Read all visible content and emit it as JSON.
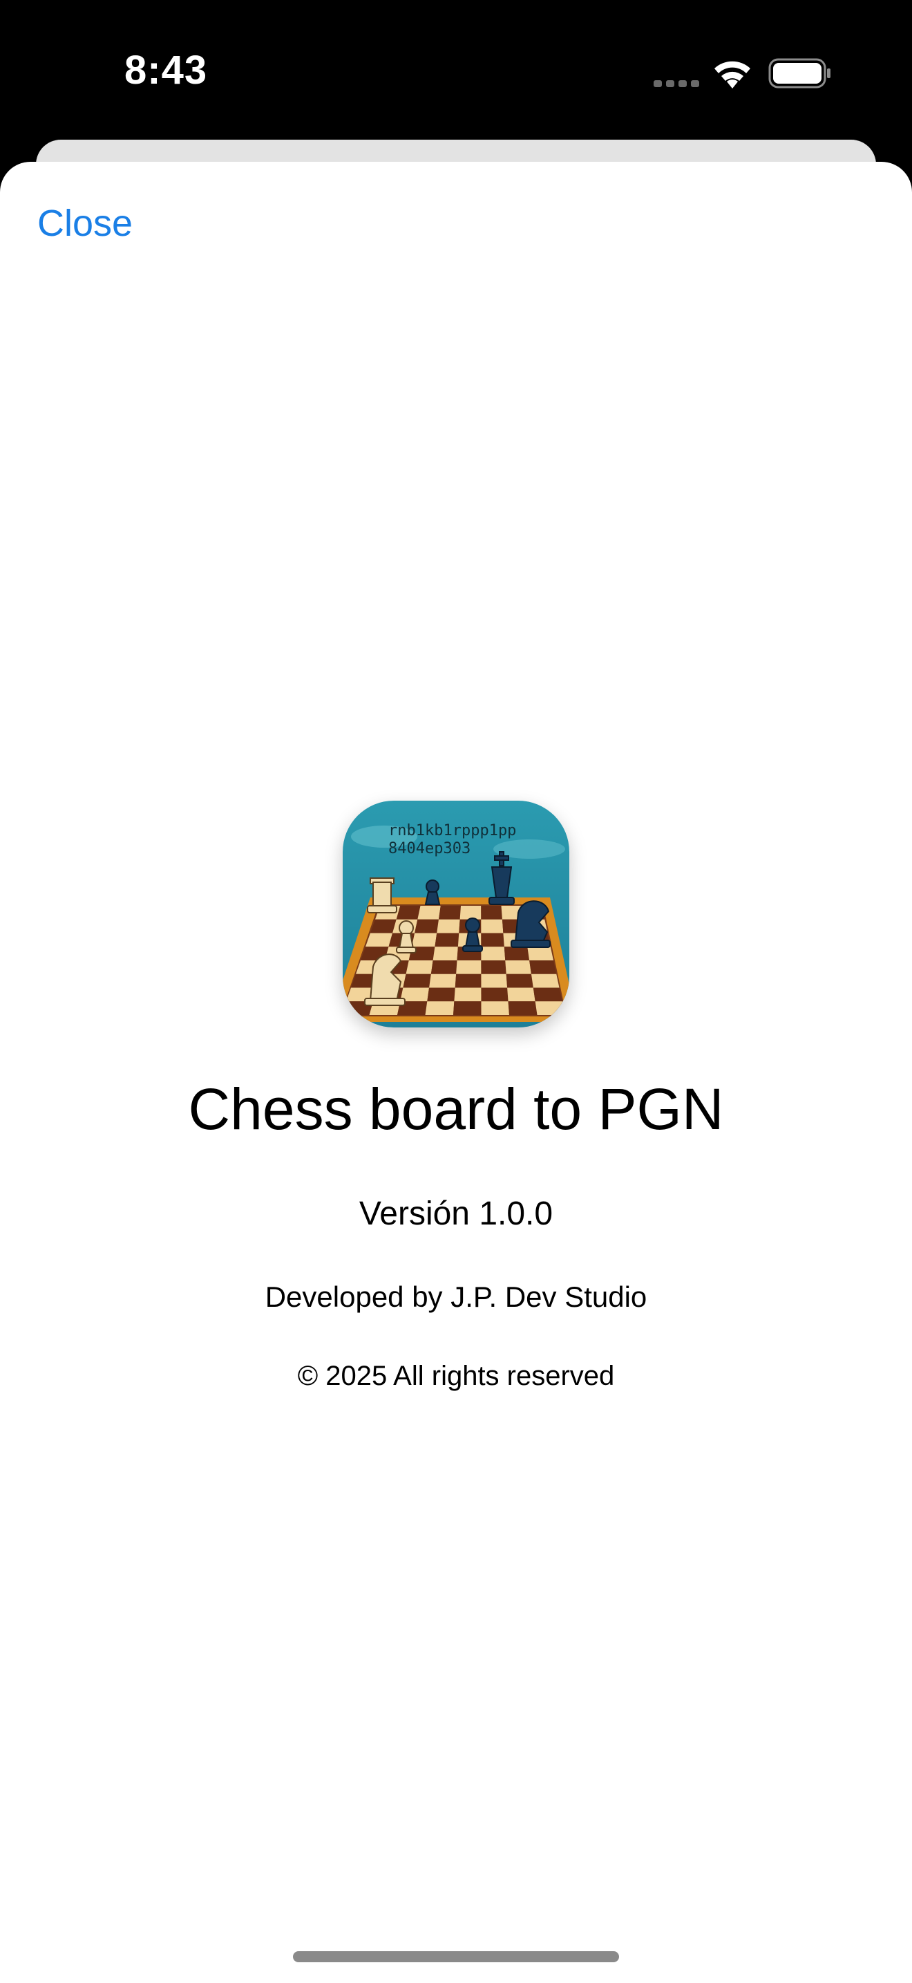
{
  "status_bar": {
    "time": "8:43",
    "icons": [
      "cellular-signal-icon",
      "wifi-icon",
      "battery-icon"
    ]
  },
  "sheet": {
    "close_label": "Close"
  },
  "about": {
    "app_icon": "chess-board-app-icon",
    "app_icon_text_line1": "rnb1kb1rppp1pp",
    "app_icon_text_line2": "8404ep303",
    "title": "Chess board to PGN",
    "version": "Versión 1.0.0",
    "developer": "Developed by J.P. Dev Studio",
    "copyright": "© 2025 All rights reserved"
  },
  "colors": {
    "accent": "#1a7fe6",
    "background": "#ffffff",
    "status_bar": "#000000"
  }
}
